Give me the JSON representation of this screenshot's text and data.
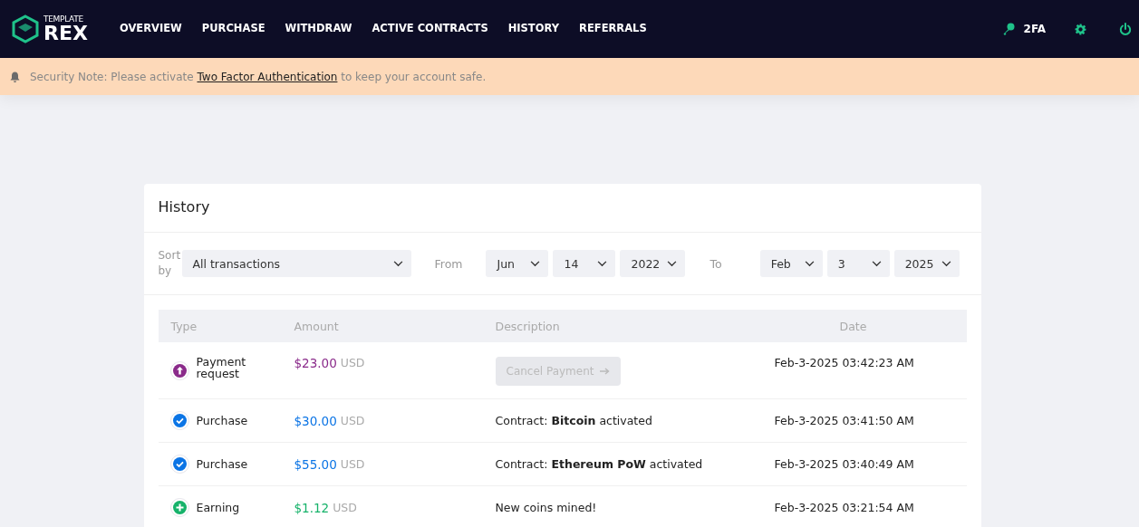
{
  "brand": {
    "top": "TEMPLATE",
    "name": "REX"
  },
  "nav": [
    {
      "label": "OVERVIEW",
      "selected": false
    },
    {
      "label": "PURCHASE",
      "selected": false
    },
    {
      "label": "WITHDRAW",
      "selected": false
    },
    {
      "label": "ACTIVE CONTRACTS",
      "selected": false
    },
    {
      "label": "HISTORY",
      "selected": false
    },
    {
      "label": "REFERRALS",
      "selected": false
    }
  ],
  "twofa": "2FA",
  "banner": {
    "before": "Security Note: Please activate",
    "link": "Two Factor Authentication",
    "after": "to keep your account safe."
  },
  "card": {
    "title": "History",
    "filters": {
      "sort_label": "Sort by",
      "sort": "All transactions",
      "from_label": "From",
      "from": [
        "Jun",
        "14",
        "2022"
      ],
      "to_label": "To",
      "to": [
        "Feb",
        "3",
        "2025"
      ]
    },
    "columns": [
      "Type",
      "Amount",
      "Description",
      "Date"
    ],
    "rows": [
      {
        "kind": "request",
        "type": "Payment request",
        "amount": "$23.00",
        "currency": "USD",
        "action": {
          "label": "Cancel Payment",
          "disabled": true
        },
        "date": "Feb-3-2025 03:42:23 AM"
      },
      {
        "kind": "purchase",
        "type": "Purchase",
        "amount": "$30.00",
        "currency": "USD",
        "description": "Contract: **Bitcoin** activated",
        "date": "Feb-3-2025 03:41:50 AM"
      },
      {
        "kind": "purchase",
        "type": "Purchase",
        "amount": "$55.00",
        "currency": "USD",
        "description": "Contract: **Ethereum PoW** activated",
        "date": "Feb-3-2025 03:40:49 AM"
      },
      {
        "kind": "earning",
        "type": "Earning",
        "amount": "$1.12",
        "currency": "USD",
        "description": "New coins mined!",
        "date": "Feb-3-2025 03:21:54 AM"
      }
    ]
  }
}
